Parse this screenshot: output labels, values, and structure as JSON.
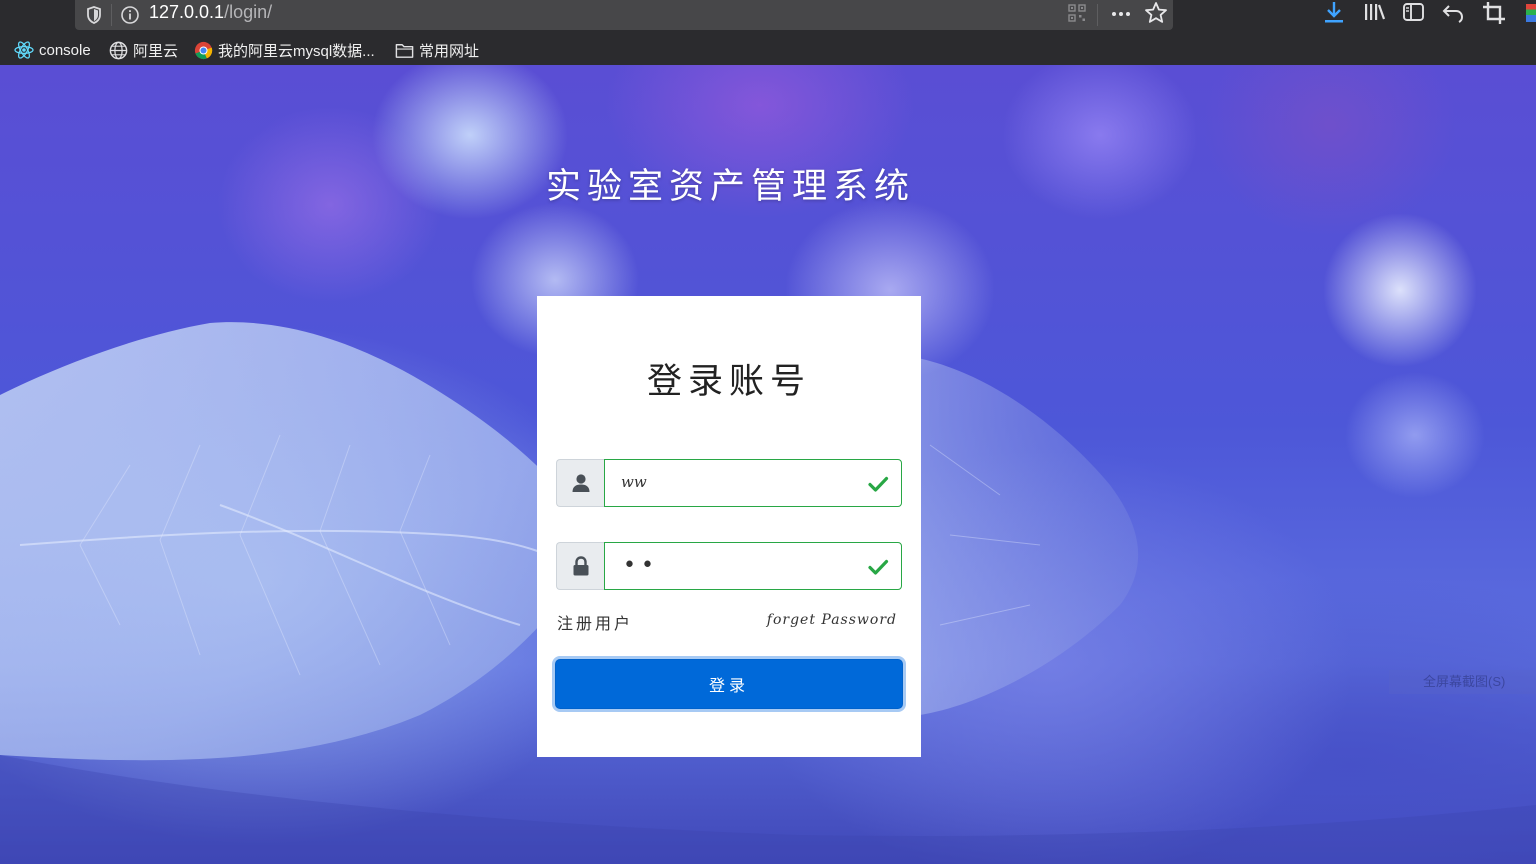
{
  "browser": {
    "url_host": "127.0.0.1",
    "url_path": "/login/",
    "bookmarks": [
      {
        "label": "console",
        "icon": "react-icon"
      },
      {
        "label": "阿里云",
        "icon": "globe-icon"
      },
      {
        "label": "我的阿里云mysql数据...",
        "icon": "chrome-icon"
      },
      {
        "label": "常用网址",
        "icon": "folder-icon"
      }
    ],
    "toolbar_icons": [
      "download-icon",
      "library-icon",
      "sidebar-icon",
      "undo-icon",
      "crop-icon"
    ]
  },
  "page": {
    "site_title": "实验室资产管理系统",
    "login_card": {
      "title": "登录账号",
      "username_value": "ww",
      "password_mask": "••",
      "register_link": "注册用户",
      "forgot_link": "forget Password",
      "submit_label": "登录"
    },
    "screenshot_hint": "全屏幕截图(S)"
  },
  "colors": {
    "primary": "#0069d9",
    "valid": "#28a745",
    "chrome_bg": "#2b2b2e"
  }
}
